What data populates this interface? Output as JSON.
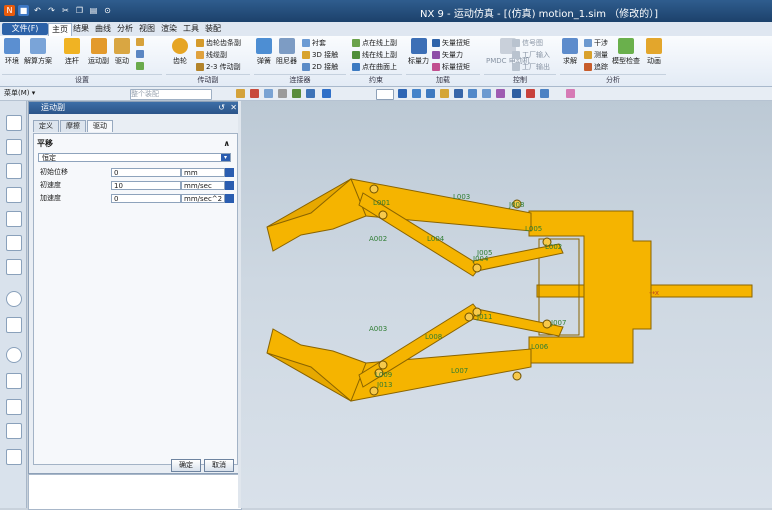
{
  "window": {
    "title": "NX 9 - 运动仿真 - [(仿真) motion_1.sim （修改的）]"
  },
  "menu": {
    "file": "文件(F)",
    "items": [
      "主页",
      "结果",
      "曲线",
      "分析",
      "视图",
      "渲染",
      "工具",
      "装配"
    ]
  },
  "ribbon": {
    "big": [
      "环境",
      "解算方案",
      "连杆",
      "运动副",
      "驱动",
      "齿轮",
      "弹簧",
      "阻尼器",
      "标量力",
      "求解",
      "模型检查",
      "动画"
    ],
    "small": [
      "齿轮齿条副",
      "线缆副",
      "2-3 传动副",
      "衬套",
      "3D 接触",
      "2D 接触",
      "点在线上副",
      "线在线上副",
      "点在曲面上",
      "矢量扭矩",
      "矢量力",
      "标量扭矩",
      "信号图",
      "工厂输入",
      "工厂输出",
      "干涉",
      "测量",
      "追踪"
    ],
    "pmdc": "PMDC 电动机",
    "groups": [
      "设置",
      "传动副",
      "连接器",
      "约束",
      "加载",
      "控制",
      "分析"
    ]
  },
  "toolbar2": {
    "menu": "菜单(M) ▾",
    "filter": "整个装配"
  },
  "panel": {
    "title": "运动副",
    "tabs": [
      "定义",
      "摩擦",
      "驱动"
    ],
    "section": "平移",
    "type": "恒定",
    "fields": [
      {
        "label": "初始位移",
        "value": "0",
        "unit": "mm"
      },
      {
        "label": "初速度",
        "value": "10",
        "unit": "mm/sec"
      },
      {
        "label": "加速度",
        "value": "0",
        "unit": "mm/sec^2"
      }
    ],
    "ok": "确定",
    "cancel": "取消"
  },
  "labels": {
    "links": [
      "L001",
      "L002",
      "L003",
      "L004",
      "L005",
      "L006",
      "L007",
      "L008",
      "L009",
      "L010",
      "L011",
      "L012",
      "L013"
    ],
    "joints": [
      "J002",
      "J003",
      "J004",
      "J005",
      "J006",
      "J007",
      "J008",
      "J009",
      "J010",
      "J011",
      "J012",
      "J013"
    ],
    "drivers": [
      "A002",
      "A003"
    ],
    "colors": {
      "part": "#f5b400",
      "edge": "#8a6400",
      "label": "#2e7d32"
    }
  }
}
